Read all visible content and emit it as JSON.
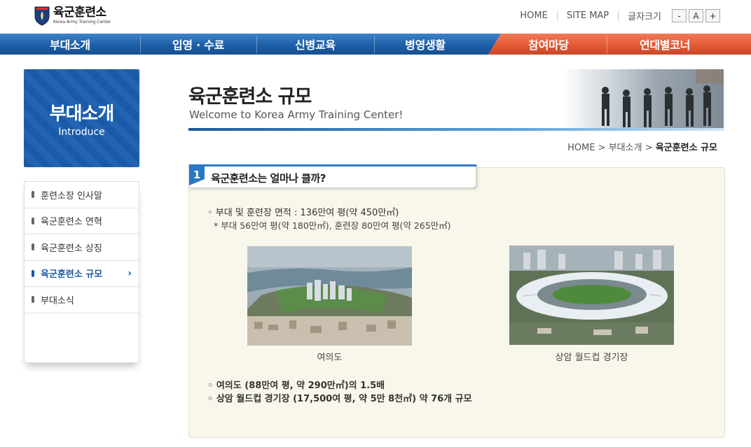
{
  "header": {
    "logo_title": "육군훈련소",
    "logo_sub": "Korea Army Training Center",
    "util": {
      "home": "HOME",
      "sitemap": "SITE MAP",
      "font_size": "글자크기",
      "minus": "-",
      "normal": "A",
      "plus": "+"
    }
  },
  "gnb": {
    "items": [
      "부대소개",
      "입영 · 수료",
      "신병교육",
      "병영생활",
      "참여마당",
      "연대별코너"
    ],
    "colors": {
      "blue": "#1d5fa8",
      "orange": "#e45a36"
    }
  },
  "lnb": {
    "title_ko": "부대소개",
    "title_en": "Introduce",
    "items": [
      {
        "label": "훈련소장 인사말"
      },
      {
        "label": "육군훈련소 연혁"
      },
      {
        "label": "육군훈련소 상징"
      },
      {
        "label": "육군훈련소 규모",
        "active": true
      },
      {
        "label": "부대소식"
      }
    ],
    "arrow": "›"
  },
  "content": {
    "title": "육군훈련소 규모",
    "subtitle": "Welcome to Korea Army Training Center!",
    "breadcrumb": {
      "home": "HOME",
      "sep": ">",
      "level1": "부대소개",
      "current": "육군훈련소 규모"
    },
    "section": {
      "number": "1",
      "title": "육군훈련소는 얼마나 클까?",
      "line1": "◦  부대 및 훈련장 면적 : 136만여 평(약 450만㎡)",
      "line2": "* 부대 56만여 평(약 180만㎡), 훈련장 80만여 평(약 265만㎡)",
      "photo1_caption": "여의도",
      "photo2_caption": "상암 월드컵 경기장",
      "line3": "◦  여의도 (88만여 평, 약 290만㎡)의 1.5배",
      "line4": "◦  상암 월드컵 경기장 (17,500여 평, 약 5만 8천㎡) 약 76개 규모"
    }
  }
}
